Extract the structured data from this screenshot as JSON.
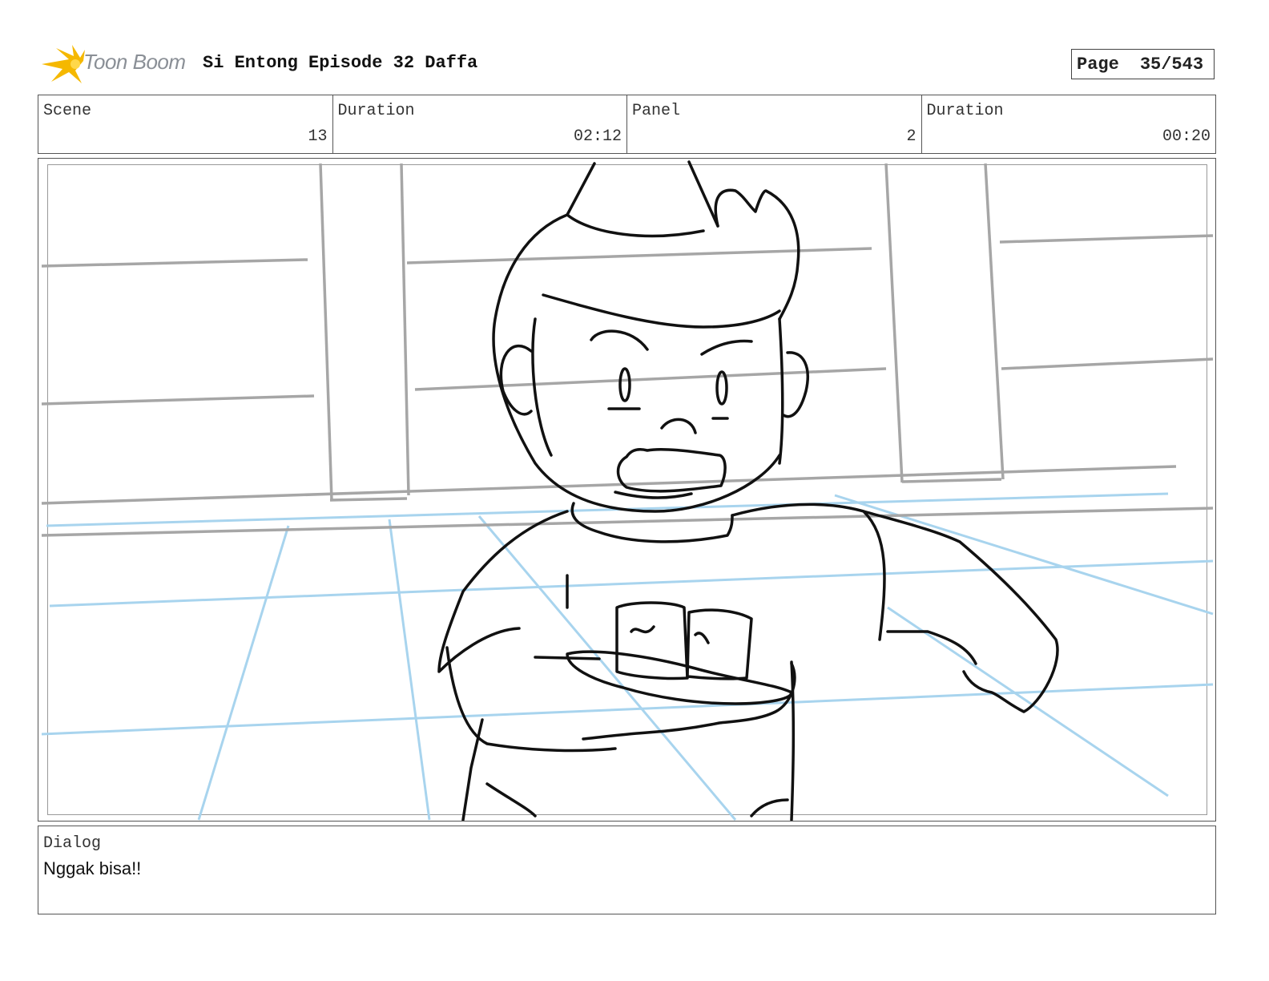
{
  "header": {
    "logo_text": "Toon Boom",
    "title": "Si Entong Episode 32 Daffa",
    "page_label": "Page",
    "page_value": "35/543"
  },
  "info": {
    "scene": {
      "label": "Scene",
      "value": "13"
    },
    "scene_duration": {
      "label": "Duration",
      "value": "02:12"
    },
    "panel": {
      "label": "Panel",
      "value": "2"
    },
    "panel_duration": {
      "label": "Duration",
      "value": "00:20"
    }
  },
  "dialog": {
    "label": "Dialog",
    "text": "Nggak bisa!!"
  },
  "colors": {
    "logo_accent": "#f5b800",
    "floor_lines": "#a8d4ee",
    "wall_lines": "#a6a6a6",
    "ink": "#111111"
  }
}
